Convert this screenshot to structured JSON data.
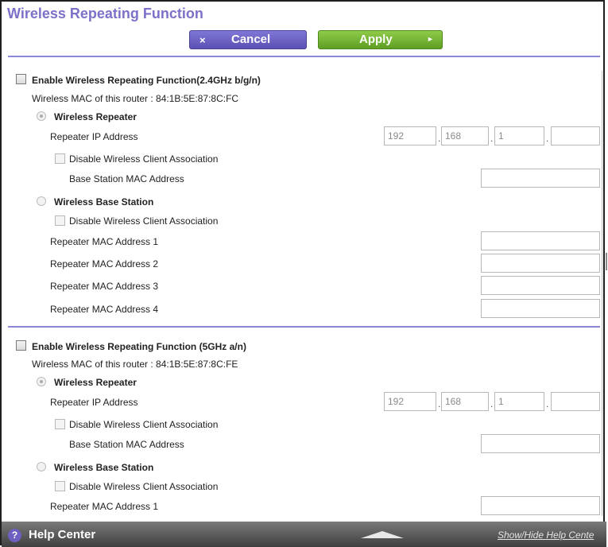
{
  "page": {
    "title": "Wireless Repeating Function"
  },
  "toolbar": {
    "cancel_icon": "×",
    "cancel_label": "Cancel",
    "apply_label": "Apply",
    "apply_icon": "►"
  },
  "section24": {
    "enable_label": "Enable Wireless Repeating Function(2.4GHz b/g/n)",
    "mac_text": "Wireless MAC of this router : 84:1B:5E:87:8C:FC",
    "repeater_label": "Wireless Repeater",
    "repeater_ip_label": "Repeater IP Address",
    "ip": [
      "192",
      "168",
      "1",
      ""
    ],
    "disable_assoc_label": "Disable Wireless Client Association",
    "base_mac_label": "Base Station MAC Address",
    "base_station_label": "Wireless Base Station",
    "disable_assoc_label2": "Disable Wireless Client Association",
    "rep_mac_labels": [
      "Repeater MAC Address 1",
      "Repeater MAC Address 2",
      "Repeater MAC Address 3",
      "Repeater MAC Address 4"
    ]
  },
  "section5": {
    "enable_label": "Enable Wireless Repeating Function (5GHz a/n)",
    "mac_text": "Wireless MAC of this router : 84:1B:5E:87:8C:FE",
    "repeater_label": "Wireless Repeater",
    "repeater_ip_label": "Repeater IP Address",
    "ip": [
      "192",
      "168",
      "1",
      ""
    ],
    "disable_assoc_label": "Disable Wireless Client Association",
    "base_mac_label": "Base Station MAC Address",
    "base_station_label": "Wireless Base Station",
    "disable_assoc_label2": "Disable Wireless Client Association",
    "rep_mac_labels": [
      "Repeater MAC Address 1"
    ]
  },
  "help": {
    "icon": "?",
    "title": "Help Center",
    "toggle_link": "Show/Hide Help Cente"
  }
}
